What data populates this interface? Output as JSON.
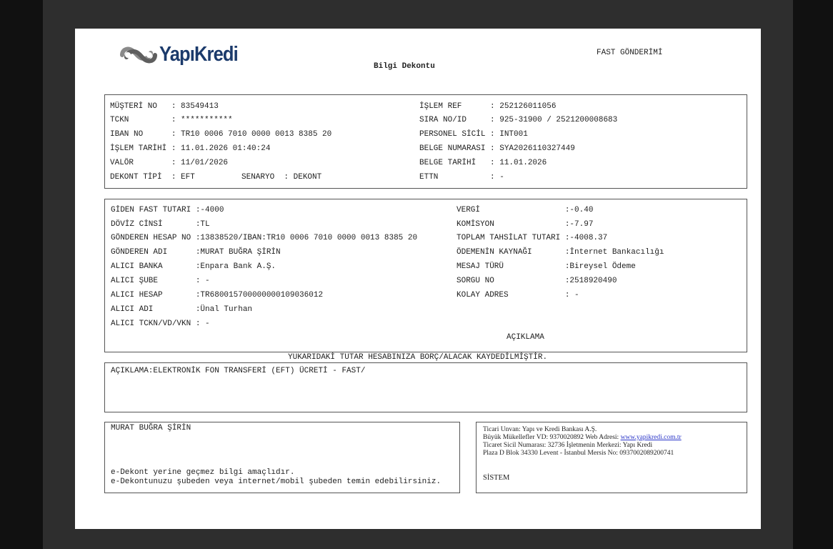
{
  "header": {
    "brand": "YapıKredi",
    "title": "Bilgi Dekontu",
    "fast_label": "FAST GÖNDERİMİ"
  },
  "customer": {
    "musteri_no": "MÜŞTERİ NO   : 83549413",
    "tckn": "TCKN         : ***********",
    "iban": "IBAN NO      : TR10 0006 7010 0000 0013 8385 20",
    "islem_tarihi": "İŞLEM TARİHİ : 11.01.2026 01:40:24",
    "valor": "VALÖR        : 11/01/2026",
    "dekont_tipi": "DEKONT TİPİ  : EFT",
    "senaryo": "SENARYO  : DEKONT",
    "islem_ref": "İŞLEM REF      : 252126011056",
    "sira_no": "SIRA NO/ID     : 925-31900 / 2521200008683",
    "personel": "PERSONEL SİCİL : INT001",
    "belge_no": "BELGE NUMARASI : SYA2026110327449",
    "belge_tarihi": "BELGE TARİHİ   : 11.01.2026",
    "ettn": "ETTN           : -"
  },
  "transfer": {
    "giden_tutar": "GİDEN FAST TUTARI :-4000",
    "doviz": "DÖVİZ CİNSİ       :TL",
    "gonderen_hesap": "GÖNDEREN HESAP NO :13838520/IBAN:TR10 0006 7010 0000 0013 8385 20",
    "gonderen_adi": "GÖNDEREN ADI      :MURAT BUĞRA ŞİRİN",
    "alici_banka": "ALICI BANKA       :Enpara Bank A.Ş.",
    "alici_sube": "ALICI ŞUBE        : -",
    "alici_hesap": "ALICI HESAP       :TR680015700000000109036012",
    "alici_adi": "ALICI ADI         :Ünal Turhan",
    "alici_tckn": "ALICI TCKN/VD/VKN : -",
    "vergi": "VERGİ                  :-0.40",
    "komisyon": "KOMİSYON               :-7.97",
    "toplam": "TOPLAM TAHSİLAT TUTARI :-4008.37",
    "kaynak": "ÖDEMENİN KAYNAĞI       :İnternet Bankacılığı",
    "mesaj_turu": "MESAJ TÜRÜ             :Bireysel Ödeme",
    "sorgu_no": "SORGU NO               :2518920490",
    "kolay_adres": "KOLAY ADRES            : -",
    "aciklama_header": "AÇIKLAMA"
  },
  "notice": "YUKARIDAKİ TUTAR HESABINIZA BORÇ/ALACAK KAYDEDİLMİŞTİR.",
  "description": "AÇIKLAMA:ELEKTRONİK FON TRANSFERİ (EFT) ÜCRETİ - FAST/",
  "footer_left": {
    "name": "MURAT BUĞRA ŞİRİN",
    "line1": "e-Dekont yerine geçmez bilgi amaçlıdır.",
    "line2": "e-Dekontunuzu şubeden veya internet/mobil şubeden temin edebilirsiniz."
  },
  "footer_right": {
    "line1": "Ticari Unvan: Yapı ve Kredi Bankası A.Ş.",
    "line2_prefix": "Büyük Mükellefler VD: 9370020892 Web Adresi: ",
    "web": "www.yapikredi.com.tr",
    "line3": "Ticaret Sicil Numarası: 32736 İşletmenin Merkezi: Yapı Kredi",
    "line4": "Plaza D Blok 34330 Levent - İstanbul Mersis No: 0937002089200741",
    "sistem": "SİSTEM"
  }
}
